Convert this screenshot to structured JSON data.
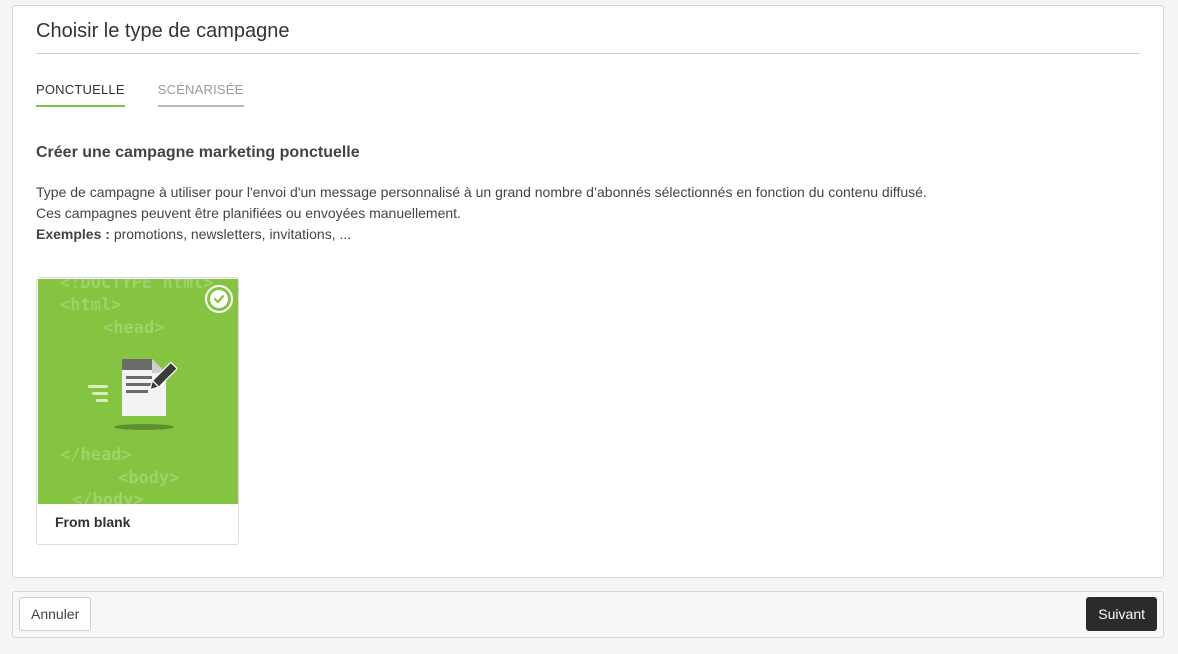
{
  "panel": {
    "title": "Choisir le type de campagne"
  },
  "tabs": [
    {
      "label": "PONCTUELLE",
      "active": true
    },
    {
      "label": "SCÉNARISÉE",
      "active": false
    }
  ],
  "section": {
    "heading": "Créer une campagne marketing ponctuelle",
    "description_line1": "Type de campagne à utiliser pour l'envoi d'un message personnalisé à un grand nombre d’abonnés sélectionnés en fonction du contenu diffusé.",
    "description_line2": "Ces campagnes peuvent être planifiées ou envoyées manuellement.",
    "examples_label": "Exemples :",
    "examples_text": " promotions, newsletters, invitations, ..."
  },
  "template_card": {
    "label": "From blank",
    "selected": true,
    "thumbnail_code_lines": [
      "<!DOCTYPE html>",
      "<html>",
      "<head>",
      "</head>",
      "<body>",
      "</body>"
    ],
    "icon": "document-edit-icon",
    "selected_icon": "check-circle-icon"
  },
  "footer": {
    "cancel_label": "Annuler",
    "next_label": "Suivant"
  },
  "colors": {
    "accent": "#7dc242",
    "thumbnail_bg": "#85c440",
    "primary_button": "#2b2b2b"
  }
}
